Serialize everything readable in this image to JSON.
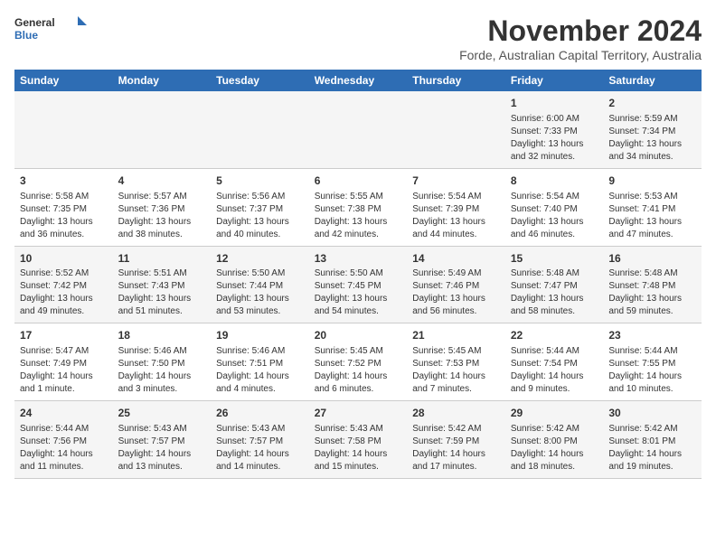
{
  "logo": {
    "line1": "General",
    "line2": "Blue"
  },
  "title": "November 2024",
  "subtitle": "Forde, Australian Capital Territory, Australia",
  "days_of_week": [
    "Sunday",
    "Monday",
    "Tuesday",
    "Wednesday",
    "Thursday",
    "Friday",
    "Saturday"
  ],
  "weeks": [
    [
      {
        "day": "",
        "detail": ""
      },
      {
        "day": "",
        "detail": ""
      },
      {
        "day": "",
        "detail": ""
      },
      {
        "day": "",
        "detail": ""
      },
      {
        "day": "",
        "detail": ""
      },
      {
        "day": "1",
        "detail": "Sunrise: 6:00 AM\nSunset: 7:33 PM\nDaylight: 13 hours and 32 minutes."
      },
      {
        "day": "2",
        "detail": "Sunrise: 5:59 AM\nSunset: 7:34 PM\nDaylight: 13 hours and 34 minutes."
      }
    ],
    [
      {
        "day": "3",
        "detail": "Sunrise: 5:58 AM\nSunset: 7:35 PM\nDaylight: 13 hours and 36 minutes."
      },
      {
        "day": "4",
        "detail": "Sunrise: 5:57 AM\nSunset: 7:36 PM\nDaylight: 13 hours and 38 minutes."
      },
      {
        "day": "5",
        "detail": "Sunrise: 5:56 AM\nSunset: 7:37 PM\nDaylight: 13 hours and 40 minutes."
      },
      {
        "day": "6",
        "detail": "Sunrise: 5:55 AM\nSunset: 7:38 PM\nDaylight: 13 hours and 42 minutes."
      },
      {
        "day": "7",
        "detail": "Sunrise: 5:54 AM\nSunset: 7:39 PM\nDaylight: 13 hours and 44 minutes."
      },
      {
        "day": "8",
        "detail": "Sunrise: 5:54 AM\nSunset: 7:40 PM\nDaylight: 13 hours and 46 minutes."
      },
      {
        "day": "9",
        "detail": "Sunrise: 5:53 AM\nSunset: 7:41 PM\nDaylight: 13 hours and 47 minutes."
      }
    ],
    [
      {
        "day": "10",
        "detail": "Sunrise: 5:52 AM\nSunset: 7:42 PM\nDaylight: 13 hours and 49 minutes."
      },
      {
        "day": "11",
        "detail": "Sunrise: 5:51 AM\nSunset: 7:43 PM\nDaylight: 13 hours and 51 minutes."
      },
      {
        "day": "12",
        "detail": "Sunrise: 5:50 AM\nSunset: 7:44 PM\nDaylight: 13 hours and 53 minutes."
      },
      {
        "day": "13",
        "detail": "Sunrise: 5:50 AM\nSunset: 7:45 PM\nDaylight: 13 hours and 54 minutes."
      },
      {
        "day": "14",
        "detail": "Sunrise: 5:49 AM\nSunset: 7:46 PM\nDaylight: 13 hours and 56 minutes."
      },
      {
        "day": "15",
        "detail": "Sunrise: 5:48 AM\nSunset: 7:47 PM\nDaylight: 13 hours and 58 minutes."
      },
      {
        "day": "16",
        "detail": "Sunrise: 5:48 AM\nSunset: 7:48 PM\nDaylight: 13 hours and 59 minutes."
      }
    ],
    [
      {
        "day": "17",
        "detail": "Sunrise: 5:47 AM\nSunset: 7:49 PM\nDaylight: 14 hours and 1 minute."
      },
      {
        "day": "18",
        "detail": "Sunrise: 5:46 AM\nSunset: 7:50 PM\nDaylight: 14 hours and 3 minutes."
      },
      {
        "day": "19",
        "detail": "Sunrise: 5:46 AM\nSunset: 7:51 PM\nDaylight: 14 hours and 4 minutes."
      },
      {
        "day": "20",
        "detail": "Sunrise: 5:45 AM\nSunset: 7:52 PM\nDaylight: 14 hours and 6 minutes."
      },
      {
        "day": "21",
        "detail": "Sunrise: 5:45 AM\nSunset: 7:53 PM\nDaylight: 14 hours and 7 minutes."
      },
      {
        "day": "22",
        "detail": "Sunrise: 5:44 AM\nSunset: 7:54 PM\nDaylight: 14 hours and 9 minutes."
      },
      {
        "day": "23",
        "detail": "Sunrise: 5:44 AM\nSunset: 7:55 PM\nDaylight: 14 hours and 10 minutes."
      }
    ],
    [
      {
        "day": "24",
        "detail": "Sunrise: 5:44 AM\nSunset: 7:56 PM\nDaylight: 14 hours and 11 minutes."
      },
      {
        "day": "25",
        "detail": "Sunrise: 5:43 AM\nSunset: 7:57 PM\nDaylight: 14 hours and 13 minutes."
      },
      {
        "day": "26",
        "detail": "Sunrise: 5:43 AM\nSunset: 7:57 PM\nDaylight: 14 hours and 14 minutes."
      },
      {
        "day": "27",
        "detail": "Sunrise: 5:43 AM\nSunset: 7:58 PM\nDaylight: 14 hours and 15 minutes."
      },
      {
        "day": "28",
        "detail": "Sunrise: 5:42 AM\nSunset: 7:59 PM\nDaylight: 14 hours and 17 minutes."
      },
      {
        "day": "29",
        "detail": "Sunrise: 5:42 AM\nSunset: 8:00 PM\nDaylight: 14 hours and 18 minutes."
      },
      {
        "day": "30",
        "detail": "Sunrise: 5:42 AM\nSunset: 8:01 PM\nDaylight: 14 hours and 19 minutes."
      }
    ]
  ]
}
